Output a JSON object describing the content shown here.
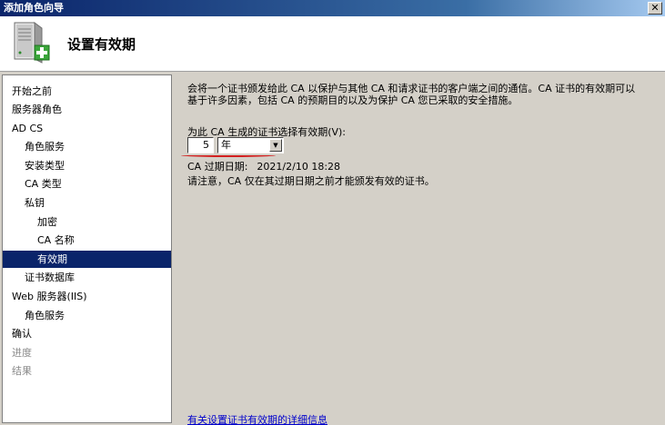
{
  "window": {
    "title": "添加角色向导",
    "close_glyph": "✕"
  },
  "header": {
    "title": "设置有效期",
    "icon": "server-add-icon"
  },
  "sidebar": {
    "items": [
      {
        "label": "开始之前",
        "state": "normal"
      },
      {
        "label": "服务器角色",
        "state": "normal"
      },
      {
        "label": "AD CS",
        "state": "normal"
      },
      {
        "label": "角色服务",
        "state": "normal"
      },
      {
        "label": "安装类型",
        "state": "normal"
      },
      {
        "label": "CA 类型",
        "state": "normal"
      },
      {
        "label": "私钥",
        "state": "normal"
      },
      {
        "label": "加密",
        "state": "normal"
      },
      {
        "label": "CA 名称",
        "state": "normal"
      },
      {
        "label": "有效期",
        "state": "selected"
      },
      {
        "label": "证书数据库",
        "state": "normal"
      },
      {
        "label": "Web 服务器(IIS)",
        "state": "normal"
      },
      {
        "label": "角色服务",
        "state": "normal"
      },
      {
        "label": "确认",
        "state": "normal"
      },
      {
        "label": "进度",
        "state": "disabled"
      },
      {
        "label": "结果",
        "state": "disabled"
      }
    ]
  },
  "main": {
    "intro_line1": "会将一个证书颁发给此 CA 以保护与其他 CA 和请求证书的客户端之间的通信。CA 证书的有效期可以",
    "intro_line2": "基于许多因素，包括 CA 的预期目的以及为保护 CA 您已采取的安全措施。",
    "period_label": "为此 CA 生成的证书选择有效期(V):",
    "period_value": "5",
    "unit_selected": "年",
    "expiry_label": "CA 过期日期:",
    "expiry_value": "2021/2/10 18:28",
    "note": "请注意，CA 仅在其过期日期之前才能颁发有效的证书。",
    "details_link": "有关设置证书有效期的详细信息"
  },
  "colors": {
    "selection": "#0a246a",
    "link": "#0000cc",
    "annotation_mark": "#d21f1f"
  }
}
